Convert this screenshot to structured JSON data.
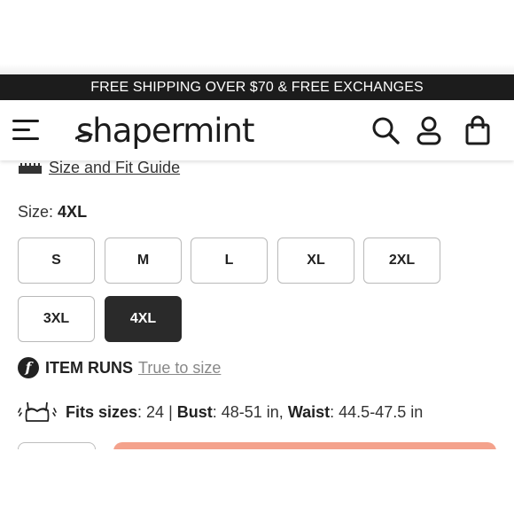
{
  "promo": {
    "text": "FREE SHIPPING OVER $70 & FREE EXCHANGES"
  },
  "header": {
    "logo_text": "shapermint",
    "icons": [
      "menu-icon",
      "search-icon",
      "account-icon",
      "cart-icon"
    ]
  },
  "size_guide": {
    "label": "Size and Fit Guide",
    "icon": "ruler-icon"
  },
  "size": {
    "label": "Size:",
    "selected": "4XL",
    "options": [
      "S",
      "M",
      "L",
      "XL",
      "2XL",
      "3XL",
      "4XL"
    ]
  },
  "item_runs": {
    "badge": "f",
    "title": "ITEM RUNS",
    "link": "True to size"
  },
  "fits": {
    "icon": "bra-icon",
    "label1": "Fits sizes",
    "value1": ": 24 | ",
    "label2": "Bust",
    "value2": ": 48-51 in, ",
    "label3": "Waist",
    "value3": ": 44.5-47.5 in"
  },
  "colors": {
    "promo_bg": "#1c1c1c",
    "selected_bg": "#2a2a2a",
    "cta": "#f4a28c"
  }
}
